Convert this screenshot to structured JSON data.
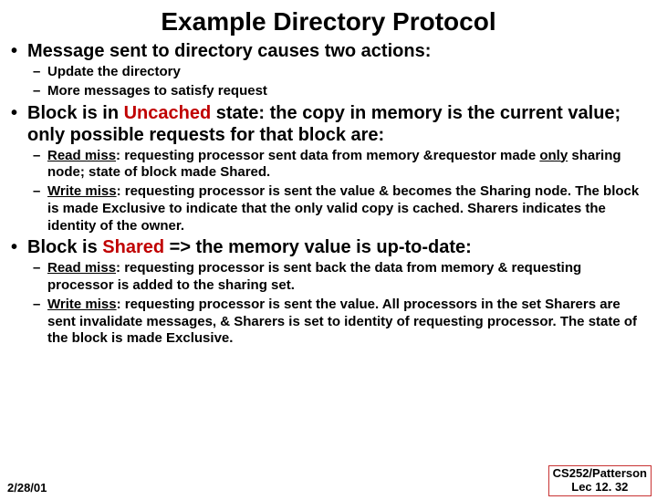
{
  "title": "Example Directory Protocol",
  "bullet1": {
    "text": "Message sent to directory causes two actions:",
    "subs": {
      "a": "Update the directory",
      "b": "More messages to satisfy request"
    }
  },
  "bullet2": {
    "pre": "Block is in ",
    "term": "Uncached",
    "post": " state: the copy in memory is the current value; only possible requests for that block are:",
    "subs": {
      "a_label": "Read miss",
      "a_text": ": requesting processor sent data from memory &requestor made ",
      "a_only": "only",
      "a_tail": " sharing node; state of block made Shared.",
      "b_label": "Write miss",
      "b_text": ": requesting processor is sent the value & becomes the Sharing node. The block is made Exclusive to indicate that the only valid copy is cached. Sharers indicates the identity of the owner."
    }
  },
  "bullet3": {
    "pre": "Block is ",
    "term": "Shared",
    "post": " => the memory value is up-to-date:",
    "subs": {
      "a_label": "Read miss",
      "a_text": ": requesting processor is sent back the data from memory & requesting processor is added to the sharing set.",
      "b_label": "Write miss",
      "b_text": ": requesting processor is sent the value. All processors in the set Sharers are sent invalidate messages, & Sharers is set to identity of requesting processor. The state of the block is made Exclusive."
    }
  },
  "footer": {
    "date": "2/28/01",
    "course": "CS252/Patterson",
    "lec": "Lec 12. 32"
  }
}
